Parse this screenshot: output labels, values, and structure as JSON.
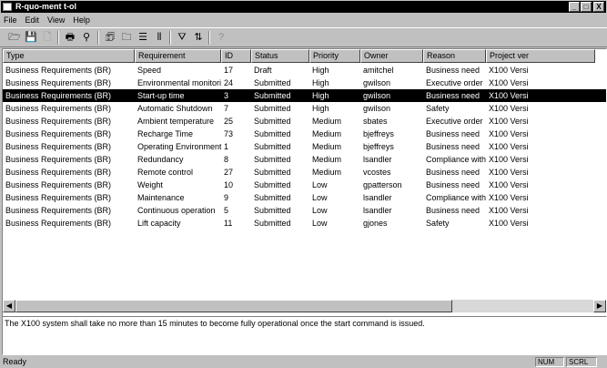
{
  "window": {
    "title": "R-quo-ment t-ol",
    "controls": [
      "_",
      "□",
      "X"
    ]
  },
  "menu": [
    "File",
    "Edit",
    "View",
    "Help"
  ],
  "toolbar": {
    "buttons": [
      {
        "name": "open-icon",
        "glyph": "🗁"
      },
      {
        "name": "save-icon",
        "glyph": "💾"
      },
      {
        "name": "new-icon",
        "glyph": "🗋"
      },
      {
        "name": "print-icon",
        "glyph": "🖶"
      },
      {
        "name": "preview-icon",
        "glyph": "⚲"
      },
      {
        "name": "properties-icon",
        "glyph": "🗊"
      },
      {
        "name": "folder-icon",
        "glyph": "🗀"
      },
      {
        "name": "list-view-icon",
        "glyph": "☰"
      },
      {
        "name": "details-view-icon",
        "glyph": "⦀"
      },
      {
        "name": "filter-icon",
        "glyph": "⛛"
      },
      {
        "name": "sort-icon",
        "glyph": "⇅"
      },
      {
        "name": "help-icon",
        "glyph": "?"
      }
    ]
  },
  "table": {
    "columns": [
      "Type",
      "Requirement",
      "ID",
      "Status",
      "Priority",
      "Owner",
      "Reason",
      "Project ver"
    ],
    "selected_index": 2,
    "rows": [
      [
        "Business Requirements (BR)",
        "Speed",
        "17",
        "Draft",
        "High",
        "amitchel",
        "Business need",
        "X100 Versi"
      ],
      [
        "Business Requirements (BR)",
        "Environmental monitoring",
        "24",
        "Submitted",
        "High",
        "gwilson",
        "Executive order",
        "X100 Versi"
      ],
      [
        "Business Requirements (BR)",
        "Start-up time",
        "3",
        "Submitted",
        "High",
        "gwilson",
        "Business need",
        "X100 Versi"
      ],
      [
        "Business Requirements (BR)",
        "Automatic Shutdown",
        "7",
        "Submitted",
        "High",
        "gwilson",
        "Safety",
        "X100 Versi"
      ],
      [
        "Business Requirements (BR)",
        "Ambient temperature",
        "25",
        "Submitted",
        "Medium",
        "sbates",
        "Executive order",
        "X100 Versi"
      ],
      [
        "Business Requirements (BR)",
        "Recharge Time",
        "73",
        "Submitted",
        "Medium",
        "bjeffreys",
        "Business need",
        "X100 Versi"
      ],
      [
        "Business Requirements (BR)",
        "Operating Environment",
        "1",
        "Submitted",
        "Medium",
        "bjeffreys",
        "Business need",
        "X100 Versi"
      ],
      [
        "Business Requirements (BR)",
        "Redundancy",
        "8",
        "Submitted",
        "Medium",
        "lsandler",
        "Compliance with a...",
        "X100 Versi"
      ],
      [
        "Business Requirements (BR)",
        "Remote control",
        "27",
        "Submitted",
        "Medium",
        "vcostes",
        "Business need",
        "X100 Versi"
      ],
      [
        "Business Requirements (BR)",
        "Weight",
        "10",
        "Submitted",
        "Low",
        "gpatterson",
        "Business need",
        "X100 Versi"
      ],
      [
        "Business Requirements (BR)",
        "Maintenance",
        "9",
        "Submitted",
        "Low",
        "lsandler",
        "Compliance with c...",
        "X100 Versi"
      ],
      [
        "Business Requirements (BR)",
        "Continuous operation",
        "5",
        "Submitted",
        "Low",
        "lsandler",
        "Business need",
        "X100 Versi"
      ],
      [
        "Business Requirements (BR)",
        "Lift capacity",
        "11",
        "Submitted",
        "Low",
        "gjones",
        "Safety",
        "X100 Versi"
      ]
    ]
  },
  "description": "The X100 system shall take no more than 15 minutes to become fully operational once the start command is issued.",
  "status": {
    "text": "Ready",
    "panels": [
      "NUM",
      "SCRL"
    ]
  }
}
